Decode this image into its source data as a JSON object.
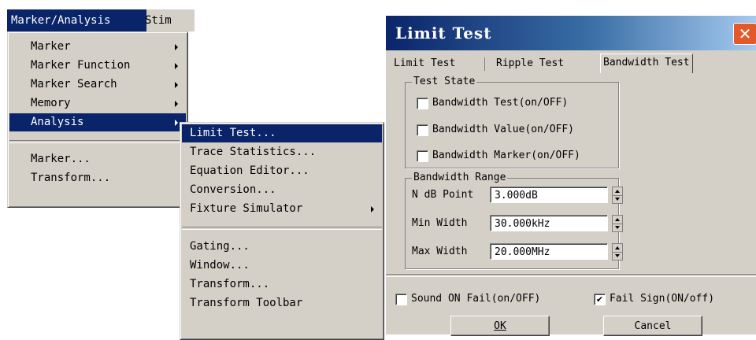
{
  "menubar": {
    "active_menu": "Marker/Analysis",
    "next_menu": "Stim"
  },
  "main_menu": {
    "items": [
      {
        "label": "Marker",
        "submenu": true
      },
      {
        "label": "Marker Function",
        "submenu": true
      },
      {
        "label": "Marker Search",
        "submenu": true
      },
      {
        "label": "Memory",
        "submenu": true
      },
      {
        "label": "Analysis",
        "submenu": true,
        "highlighted": true
      },
      {
        "label": "Marker...",
        "submenu": false
      },
      {
        "label": "Transform...",
        "submenu": false
      }
    ]
  },
  "analysis_menu": {
    "items": [
      {
        "label": "Limit Test...",
        "highlighted": true
      },
      {
        "label": "Trace Statistics..."
      },
      {
        "label": "Equation Editor..."
      },
      {
        "label": "Conversion..."
      },
      {
        "label": "Fixture Simulator",
        "submenu": true
      },
      {
        "label": "Gating..."
      },
      {
        "label": "Window..."
      },
      {
        "label": "Transform..."
      },
      {
        "label": "Transform Toolbar"
      }
    ]
  },
  "dialog": {
    "title": "Limit Test",
    "close_label": "✕",
    "tabs": [
      "Limit Test",
      "Ripple Test",
      "Bandwidth Test"
    ],
    "active_tab": "Bandwidth Test",
    "test_state": {
      "title": "Test State",
      "checkboxes": [
        {
          "label": "Bandwidth Test(on/OFF)",
          "checked": false
        },
        {
          "label": "Bandwidth Value(on/OFF)",
          "checked": false
        },
        {
          "label": "Bandwidth Marker(on/OFF)",
          "checked": false
        }
      ]
    },
    "bandwidth_range": {
      "title": "Bandwidth Range",
      "n_db_point": {
        "label": "N dB Point",
        "value": "3.000dB"
      },
      "min_width": {
        "label": "Min Width",
        "value": "30.000kHz"
      },
      "max_width": {
        "label": "Max Width",
        "value": "20.000MHz"
      }
    },
    "sound_on_fail": {
      "label": "Sound ON Fail(on/OFF)",
      "checked": false
    },
    "fail_sign": {
      "label": "Fail Sign(ON/off)",
      "checked": true,
      "mark": "✔"
    },
    "ok_label": "OK",
    "cancel_label": "Cancel"
  }
}
